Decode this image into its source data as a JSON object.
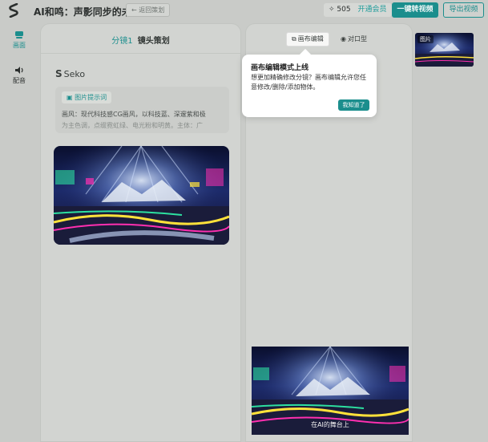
{
  "topbar": {
    "app_title": "AI和鸣：声影同步的未来",
    "back_label": "← 返回策划",
    "credits_value": "505",
    "vip_label": "开通会员",
    "primary_label": "一键转视频",
    "export_label": "导出视频"
  },
  "sidenav": {
    "items": [
      {
        "label": "画面"
      },
      {
        "label": "配音"
      }
    ]
  },
  "left_panel": {
    "shot_label": "分镜1",
    "title": "镜头策划",
    "brand": "Seko",
    "prompt_tag": "图片提示词",
    "prompt_line1": "画风：现代科技感CG画风，以科技蓝、深邃紫和极",
    "prompt_line2": "为主色调，点缀霓虹绿、电光粉和明黄。主体：广"
  },
  "right_panel": {
    "tab_canvas": "画布编辑",
    "tab_lipsync": "对口型",
    "subtitle": "在AI的舞台上"
  },
  "thumbnail": {
    "label": "图片"
  },
  "popover": {
    "title": "画布编辑模式上线",
    "body": "想更加精确修改分镜？画布编辑允许您任意修改/删除/添加物体。",
    "button": "我知道了"
  },
  "colors": {
    "accent": "#1b8e8d",
    "background": "#c9cbc8"
  }
}
